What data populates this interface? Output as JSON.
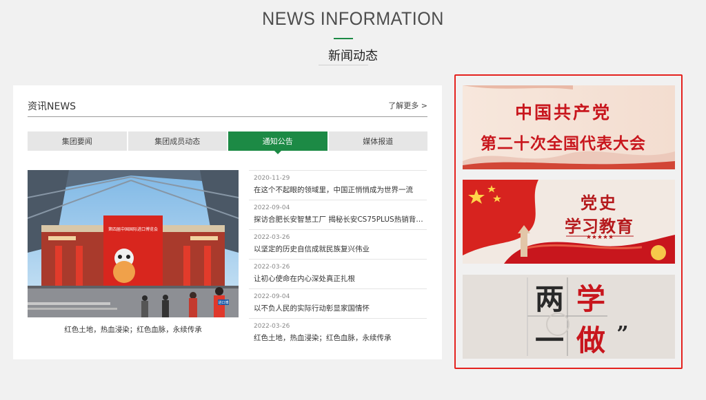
{
  "section": {
    "title_en": "NEWS INFORMATION",
    "title_cn": "新闻动态"
  },
  "panel": {
    "title": "资讯NEWS",
    "more_label": "了解更多 >"
  },
  "tabs": [
    {
      "label": "集团要闻",
      "active": false
    },
    {
      "label": "集团成员动态",
      "active": false
    },
    {
      "label": "通知公告",
      "active": true
    },
    {
      "label": "媒体报道",
      "active": false
    }
  ],
  "feature": {
    "caption": "红色土地，热血浸染；红色血脉，永续传承",
    "photo_sign_line": "第四届中国国际进口博览会",
    "photo_badge": "进口博"
  },
  "news": [
    {
      "date": "2020-11-29",
      "title": "在这个不起眼的领域里，中国正悄悄成为世界一流"
    },
    {
      "date": "2022-09-04",
      "title": "探访合肥长安智慧工厂 揭秘长安CS75PLUS热销背后..."
    },
    {
      "date": "2022-03-26",
      "title": "以坚定的历史自信成就民族复兴伟业"
    },
    {
      "date": "2022-03-26",
      "title": "让初心使命在内心深处真正扎根"
    },
    {
      "date": "2022-09-04",
      "title": "以不负人民的实际行动彰显家国情怀"
    },
    {
      "date": "2022-03-26",
      "title": "红色土地，热血浸染；红色血脉，永续传承"
    }
  ],
  "banners": [
    {
      "line1": "中国共产党",
      "line2": "第二十次全国代表大会"
    },
    {
      "line1": "党史",
      "line2": "学习教育"
    },
    {
      "char1": "两",
      "char2": "学",
      "char3": "一",
      "char4": "做",
      "quote": "”"
    }
  ],
  "colors": {
    "accent_green": "#1c8a45",
    "highlight_red": "#e4211d",
    "banner_red": "#c8161d"
  }
}
